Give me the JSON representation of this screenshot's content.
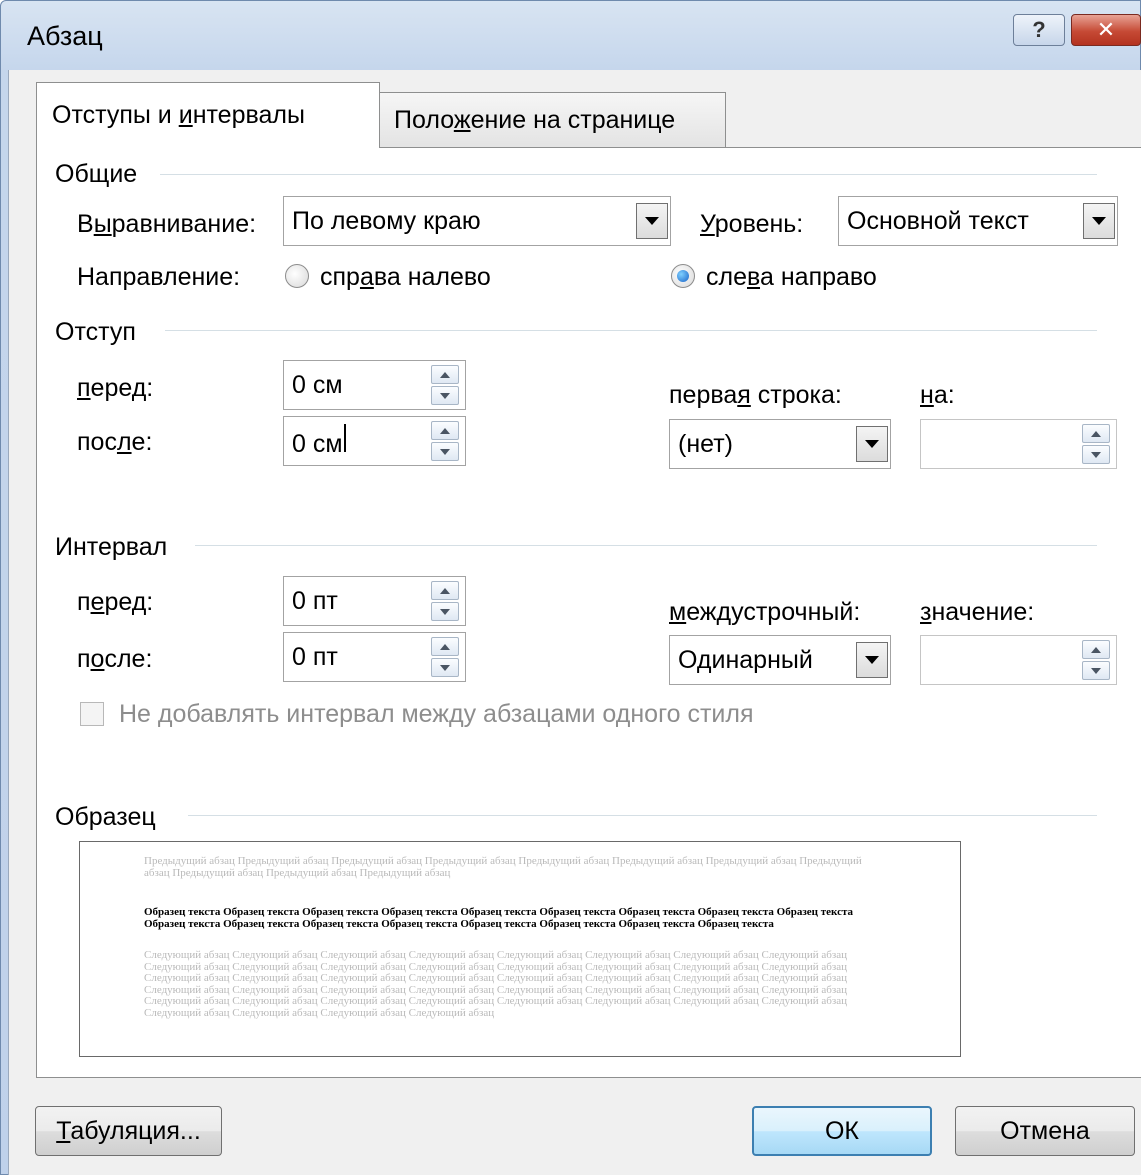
{
  "window": {
    "title": "Абзац",
    "help_label": "?",
    "close_label": "✕"
  },
  "tabs": [
    {
      "label_pre": "Отступы и ",
      "label_u": "и",
      "label_post": "нтервалы",
      "active": true
    },
    {
      "label_pre": "Поло",
      "label_u": "ж",
      "label_post": "ение на странице",
      "active": false
    }
  ],
  "general": {
    "heading": "Общие",
    "alignment_label_pre": "В",
    "alignment_label_u": "ы",
    "alignment_label_post": "равнивание:",
    "alignment_value": "По левому краю",
    "level_label_u": "У",
    "level_label_post": "ровень:",
    "level_value": "Основной текст",
    "direction_label": "Направление:",
    "rtl_pre": "спр",
    "rtl_u": "а",
    "rtl_post": "ва налево",
    "ltr_pre": "сле",
    "ltr_u": "в",
    "ltr_post": "а направо",
    "direction_selected": "ltr"
  },
  "indent": {
    "heading": "Отступ",
    "before_u": "п",
    "before_post": "еред:",
    "before_value": "0 см",
    "after_pre": "пос",
    "after_u": "л",
    "after_post": "е:",
    "after_value": "0 см",
    "first_line_pre": "перва",
    "first_line_u": "я",
    "first_line_post": " строка:",
    "first_line_value": "(нет)",
    "by_u": "н",
    "by_post": "а:",
    "by_value": ""
  },
  "spacing": {
    "heading": "Интервал",
    "before_pre": "п",
    "before_u": "е",
    "before_post": "ред:",
    "before_value": "0 пт",
    "after_pre": "п",
    "after_u": "о",
    "after_post": "сле:",
    "after_value": "0 пт",
    "line_label_u": "м",
    "line_label_post": "еждустрочный:",
    "line_value": "Одинарный",
    "value_label_u": "з",
    "value_label_post": "начение:",
    "value_value": "",
    "no_space_label": "Не добавлять интервал между абзацами одного стиля",
    "no_space_checked": false
  },
  "preview": {
    "heading": "Образец",
    "previous_text": "Предыдущий абзац Предыдущий абзац Предыдущий абзац Предыдущий абзац Предыдущий абзац Предыдущий абзац Предыдущий абзац Предыдущий абзац Предыдущий абзац Предыдущий абзац Предыдущий абзац",
    "sample_text": "Образец текста Образец текста Образец текста Образец текста Образец текста Образец текста Образец текста Образец текста Образец текста Образец текста Образец текста Образец текста Образец текста Образец текста Образец текста Образец текста Образец текста",
    "next_text": "Следующий абзац Следующий абзац Следующий абзац Следующий абзац Следующий абзац Следующий абзац Следующий абзац Следующий абзац Следующий абзац Следующий абзац Следующий абзац Следующий абзац Следующий абзац Следующий абзац Следующий абзац Следующий абзац Следующий абзац Следующий абзац Следующий абзац Следующий абзац Следующий абзац Следующий абзац Следующий абзац Следующий абзац Следующий абзац Следующий абзац Следующий абзац Следующий абзац Следующий абзац Следующий абзац Следующий абзац Следующий абзац Следующий абзац Следующий абзац Следующий абзац Следующий абзац Следующий абзац Следующий абзац Следующий абзац Следующий абзац Следующий абзац Следующий абзац Следующий абзац Следующий абзац"
  },
  "buttons": {
    "tabs_u": "Т",
    "tabs_post": "абуляция...",
    "ok_label": "ОК",
    "cancel_label": "Отмена"
  },
  "icons": {
    "combo_arrow": "chevron-down-icon",
    "spin_up": "spin-up-icon",
    "spin_down": "spin-down-icon"
  },
  "colors": {
    "accent": "#3c7fb1",
    "close": "#c64a35",
    "disabled_text": "#8d8d8d",
    "preview_gray": "#b9b9b9"
  }
}
